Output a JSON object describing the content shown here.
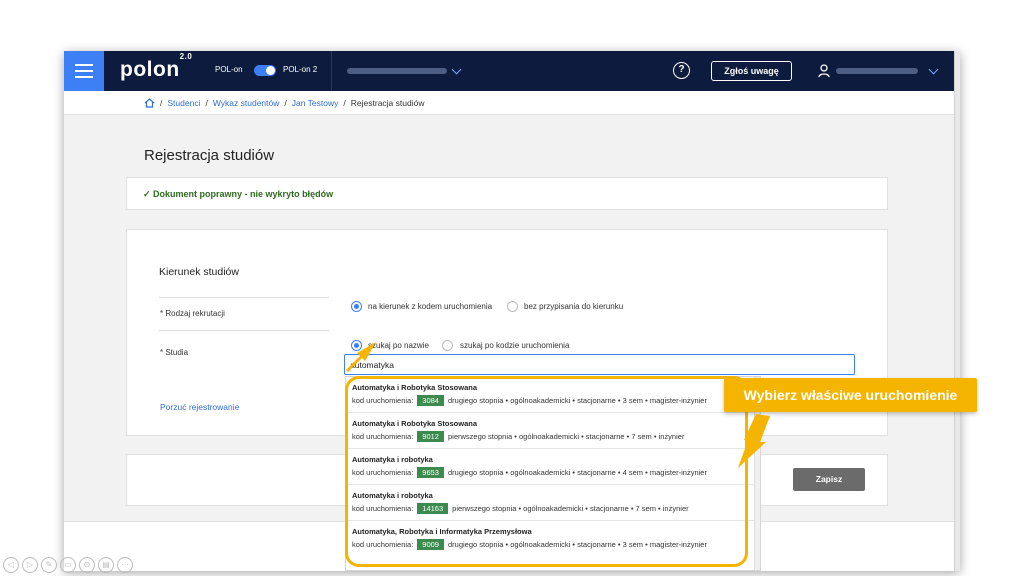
{
  "topbar": {
    "logo": "polon",
    "logo_version": "2.0",
    "switch_left": "POL-on",
    "switch_right": "POL-on 2",
    "help_icon": "?",
    "report_button": "Zgłoś uwagę"
  },
  "breadcrumb": {
    "items": [
      "Studenci",
      "Wykaz studentów",
      "Jan Testowy"
    ],
    "current": "Rejestracja studiów",
    "separator": "/"
  },
  "page": {
    "title": "Rejestracja studiów",
    "success_message": "✓ Dokument poprawny - nie wykryto błędów"
  },
  "form": {
    "section_title": "Kierunek studiów",
    "recruitment_label": "* Rodzaj rekrutacji",
    "recruitment_options": [
      "na kierunek z kodem uruchomienia",
      "bez przypisania do kierunku"
    ],
    "studies_label": "* Studia",
    "search_options": [
      "szukaj po nazwie",
      "szukaj po kodzie uruchomienia"
    ],
    "search_value": "automatyka",
    "cancel_link": "Porzuć rejestrowanie",
    "save_button": "Zapisz"
  },
  "dropdown": {
    "code_label": "kod uruchomienia:",
    "items": [
      {
        "name": "Automatyka i Robotyka Stosowana",
        "code": "3084",
        "details": "drugiego stopnia • ogólnoakademicki • stacjonarne • 3 sem • magister-inżynier"
      },
      {
        "name": "Automatyka i Robotyka Stosowana",
        "code": "9012",
        "details": "pierwszego stopnia • ogólnoakademicki • stacjonarne • 7 sem • inżynier"
      },
      {
        "name": "Automatyka i robotyka",
        "code": "9653",
        "details": "drugiego stopnia • ogólnoakademicki • stacjonarne • 4 sem • magister-inżynier"
      },
      {
        "name": "Automatyka i robotyka",
        "code": "14163",
        "details": "pierwszego stopnia • ogólnoakademicki • stacjonarne • 7 sem • inżynier"
      },
      {
        "name": "Automatyka, Robotyka i Informatyka Przemysłowa",
        "code": "9009",
        "details": "drugiego stopnia • ogólnoakademicki • stacjonarne • 3 sem • magister-inżynier"
      }
    ]
  },
  "callout": {
    "text": "Wybierz właściwe uruchomienie",
    "color": "#f5b400"
  },
  "colors": {
    "topbar": "#0d1b3e",
    "accent": "#3d7ff5",
    "code_badge": "#3c8a4e",
    "success_text": "#2e6b1f"
  }
}
